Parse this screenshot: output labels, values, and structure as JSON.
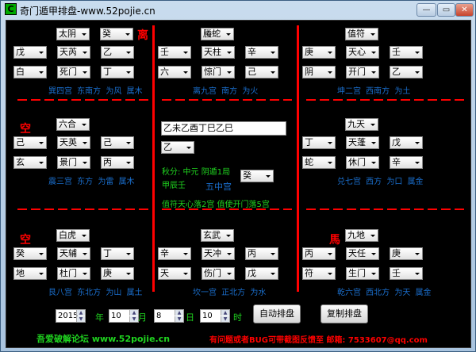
{
  "window": {
    "title": "奇门遁甲排盘-www.52pojie.cn",
    "icon_letter": "C",
    "minimize": "—",
    "maximize": "▭",
    "close": "✕"
  },
  "palaces": [
    {
      "mark": "离",
      "top": "太阴",
      "top_right": "癸",
      "r2": [
        "戊",
        "天芮",
        "乙"
      ],
      "r3": [
        "白",
        "死门",
        "丁"
      ],
      "info": "巽四宫 东南方 为风 属木"
    },
    {
      "mark": "",
      "top": "螣蛇",
      "top_right": "",
      "r2": [
        "壬",
        "天柱",
        "辛"
      ],
      "r3": [
        "六",
        "惊门",
        "己"
      ],
      "info": "离九宫 南方 为火"
    },
    {
      "mark": "",
      "top": "值符",
      "top_right": "",
      "r2": [
        "庚",
        "天心",
        "壬"
      ],
      "r3": [
        "阴",
        "开门",
        "乙"
      ],
      "info": "坤二宫 西南方 为土"
    },
    {
      "mark": "空",
      "top": "六合",
      "top_right": "",
      "r2": [
        "己",
        "天英",
        "己"
      ],
      "r3": [
        "玄",
        "景门",
        "丙"
      ],
      "info": "震三宫 东方 为雷 属木"
    },
    {
      "mark": "",
      "top": "",
      "top_right": "",
      "r2": [],
      "r3": [],
      "info": ""
    },
    {
      "mark": "",
      "top": "九天",
      "top_right": "",
      "r2": [
        "丁",
        "天蓬",
        "戊"
      ],
      "r3": [
        "蛇",
        "休门",
        "辛"
      ],
      "info": "兑七宫 西方 为口 属金"
    },
    {
      "mark": "空",
      "top": "白虎",
      "top_right": "",
      "r2": [
        "癸",
        "天辅",
        "丁"
      ],
      "r3": [
        "地",
        "杜门",
        "庚"
      ],
      "info": "艮八宫 东北方 为山 属土"
    },
    {
      "mark": "",
      "top": "玄武",
      "top_right": "",
      "r2": [
        "辛",
        "天冲",
        "丙"
      ],
      "r3": [
        "天",
        "伤门",
        "戊"
      ],
      "info": "坎一宫 正北方 为水"
    },
    {
      "mark": "馬",
      "top": "九地",
      "top_right": "",
      "r2": [
        "丙",
        "天任",
        "庚"
      ],
      "r3": [
        "符",
        "生门",
        "壬"
      ],
      "info": "乾六宫 西北方 为天 属金"
    }
  ],
  "center": {
    "ganzhi": "乙未乙酉丁巳乙巳",
    "select1": "乙",
    "jieqi": "秋分: 中元 阴遁1局",
    "xun": "甲辰壬",
    "palace": "五中宫",
    "select2": "癸",
    "zhifu": "值符天心落2宫 值使开门落5宫"
  },
  "datetime": {
    "year": "2015",
    "year_label": "年",
    "month": "10",
    "month_label": "月",
    "day": "8",
    "day_label": "日",
    "hour": "10",
    "hour_label": "时"
  },
  "buttons": {
    "auto": "自动排盘",
    "copy": "复制排盘"
  },
  "footer": {
    "forum": "吾爱破解论坛 www.52pojie.cn",
    "feedback": "有问题或者BUG可带截图反馈至 邮箱: 7533607@qq.com"
  },
  "colors": {
    "background": "#000000",
    "divider": "#ff0000",
    "info_text": "#1a6ecc",
    "green_text": "#1fd41f"
  }
}
